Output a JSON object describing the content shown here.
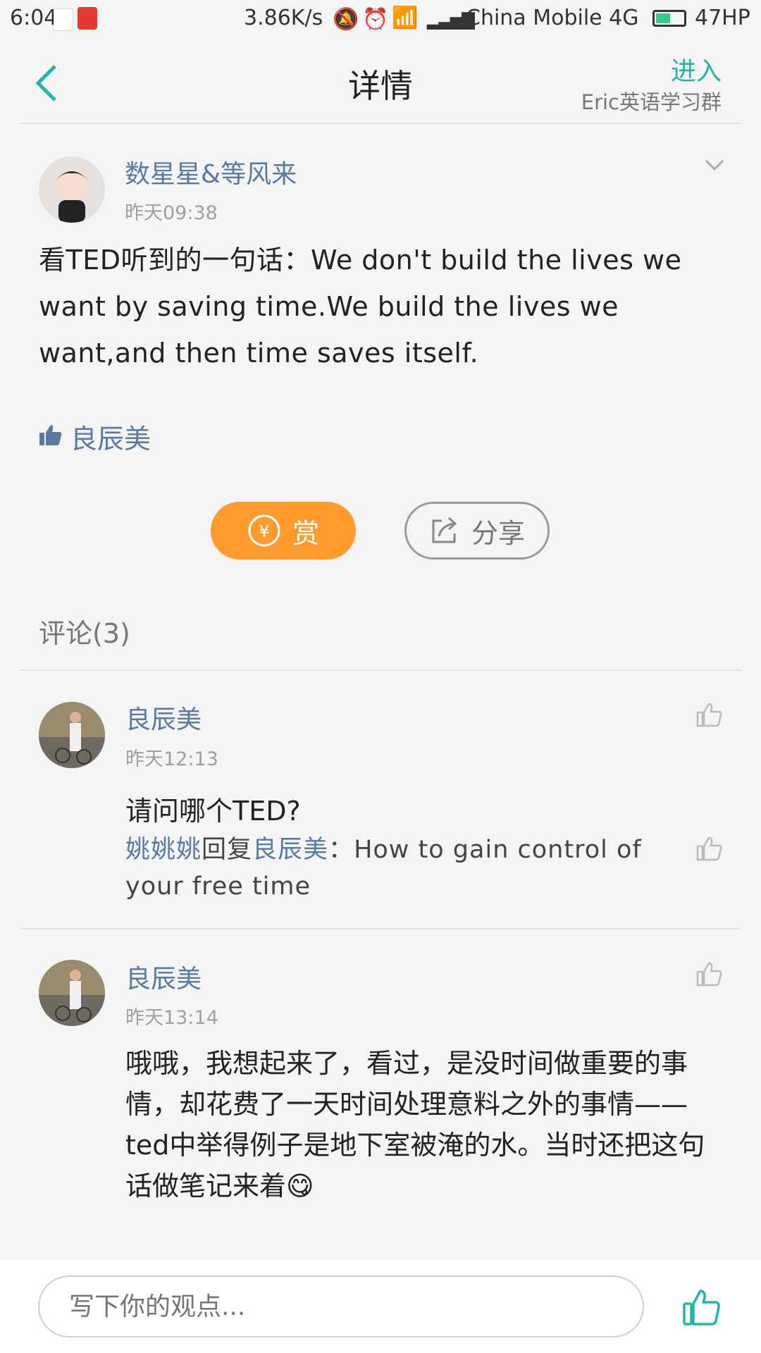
{
  "status_bar": {
    "time": "6:04",
    "speed": "3.86K/s",
    "carrier": "China Mobile 4G",
    "battery": "47HP"
  },
  "header": {
    "title": "详情",
    "enter": "进入",
    "group": "Eric英语学习群"
  },
  "post": {
    "author": "数星星&等风来",
    "time": "昨天09:38",
    "text": "看TED听到的一句话：We don't build the lives we want by saving time.We build the lives we want,and then time saves itself.",
    "liked_by": "良辰美"
  },
  "actions": {
    "reward": "赏",
    "share": "分享"
  },
  "comments_header": "评论(3)",
  "comments": [
    {
      "author": "良辰美",
      "time": "昨天12:13",
      "text": "请问哪个TED?",
      "reply": {
        "from": "姚姚姚",
        "verb": "回复",
        "to": "良辰美",
        "sep": "：",
        "text": "How to gain control of your free time"
      }
    },
    {
      "author": "良辰美",
      "time": "昨天13:14",
      "text": "哦哦，我想起来了，看过，是没时间做重要的事情，却花费了一天时间处理意料之外的事情——ted中举得例子是地下室被淹的水。当时还把这句话做笔记来着😋"
    }
  ],
  "input": {
    "placeholder": "写下你的观点..."
  },
  "colors": {
    "accent": "#23b5a8",
    "name": "#5a7aa2",
    "reward": "#ff9a2e"
  }
}
